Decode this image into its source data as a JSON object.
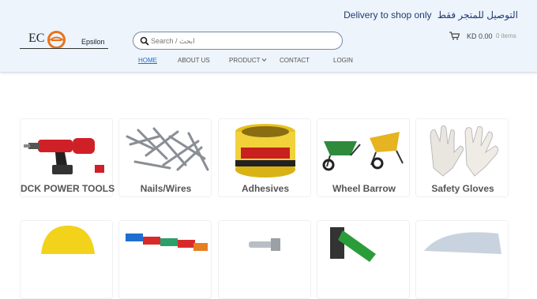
{
  "announcement": {
    "text": "Delivery to shop only",
    "arabic": "التوصيل للمتجر فقط"
  },
  "logo": {
    "mark": "EC",
    "name": "Epsilon"
  },
  "search": {
    "placeholder": "Search / ابحث",
    "value": "Search / ابحث"
  },
  "cart": {
    "amount": "KD 0.00",
    "items": "0 items"
  },
  "nav": [
    {
      "label": "HOME"
    },
    {
      "label": "ABOUT US"
    },
    {
      "label": "PRODUCT"
    },
    {
      "label": "CONTACT"
    },
    {
      "label": "LOGIN"
    }
  ],
  "categories": [
    {
      "label": "DCK POWER TOOLS"
    },
    {
      "label": "Nails/Wires"
    },
    {
      "label": "Adhesives"
    },
    {
      "label": "Wheel Barrow"
    },
    {
      "label": "Safety Gloves"
    }
  ],
  "colors": {
    "accent": "#1a6ed8",
    "header_bg": "#eef4fb",
    "announce": "#1d3c72",
    "logo_orange": "#e8731c"
  }
}
